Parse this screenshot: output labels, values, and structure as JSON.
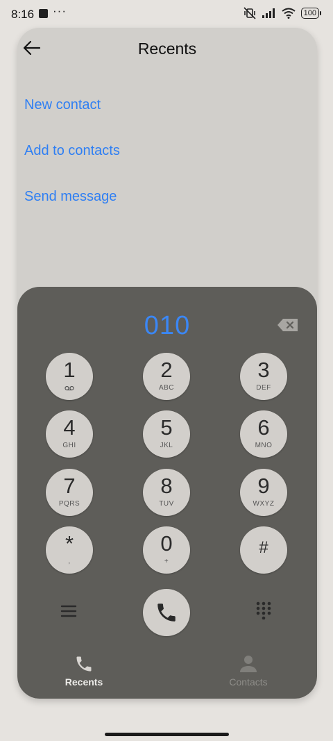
{
  "status": {
    "time": "8:16",
    "dots": "···",
    "battery": "100"
  },
  "header": {
    "title": "Recents"
  },
  "actions": [
    "New contact",
    "Add to contacts",
    "Send message"
  ],
  "dialer": {
    "number": "010",
    "keys": [
      {
        "digit": "1",
        "sub": "୭"
      },
      {
        "digit": "2",
        "sub": "ABC"
      },
      {
        "digit": "3",
        "sub": "DEF"
      },
      {
        "digit": "4",
        "sub": "GHI"
      },
      {
        "digit": "5",
        "sub": "JKL"
      },
      {
        "digit": "6",
        "sub": "MNO"
      },
      {
        "digit": "7",
        "sub": "PQRS"
      },
      {
        "digit": "8",
        "sub": "TUV"
      },
      {
        "digit": "9",
        "sub": "WXYZ"
      },
      {
        "digit": "*",
        "sub": ","
      },
      {
        "digit": "0",
        "sub": "+"
      },
      {
        "digit": "#",
        "sub": ""
      }
    ]
  },
  "nav": {
    "recents": "Recents",
    "contacts": "Contacts"
  },
  "colors": {
    "accent": "#2f7ff3",
    "dialer_bg": "#5e5d59",
    "key_bg": "#d2cfcb"
  }
}
